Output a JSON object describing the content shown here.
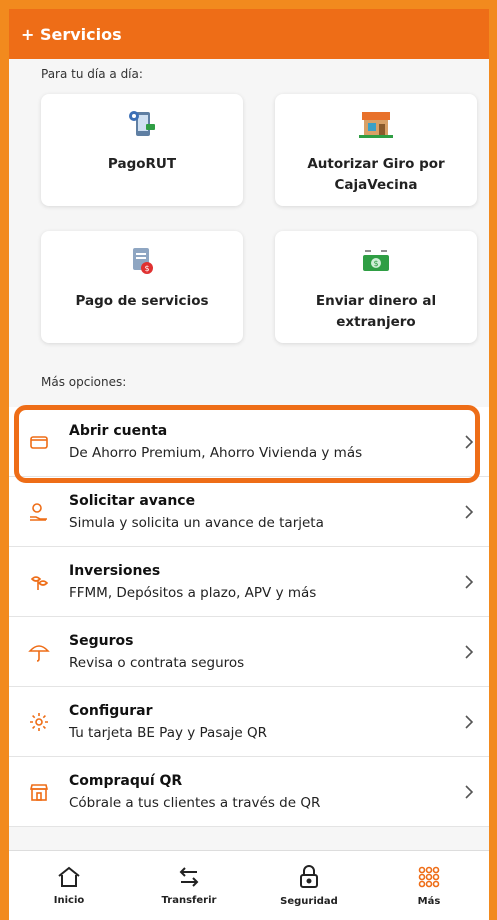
{
  "header": {
    "title": "+ Servicios"
  },
  "sections": {
    "daily_label": "Para tu día a día:",
    "more_label": "Más opciones:"
  },
  "cards": [
    {
      "label": "PagoRUT",
      "icon": "phone-payment-icon"
    },
    {
      "label": "Autorizar Giro por CajaVecina",
      "icon": "storefront-icon"
    },
    {
      "label": "Pago de servicios",
      "icon": "bill-icon"
    },
    {
      "label": "Enviar dinero al extranjero",
      "icon": "money-transfer-icon"
    }
  ],
  "options": [
    {
      "title": "Abrir cuenta",
      "subtitle": "De Ahorro Premium, Ahorro Vivienda y más",
      "icon": "wallet-icon"
    },
    {
      "title": "Solicitar avance",
      "subtitle": "Simula y solicita un avance de tarjeta",
      "icon": "hand-money-icon"
    },
    {
      "title": "Inversiones",
      "subtitle": "FFMM, Depósitos a plazo, APV y más",
      "icon": "plant-icon"
    },
    {
      "title": "Seguros",
      "subtitle": "Revisa o contrata seguros",
      "icon": "umbrella-icon"
    },
    {
      "title": "Configurar",
      "subtitle": "Tu tarjeta BE Pay y Pasaje QR",
      "icon": "gear-icon"
    },
    {
      "title": "Compraquí QR",
      "subtitle": "Cóbrale a tus clientes a través de QR",
      "icon": "shop-icon"
    }
  ],
  "tabs": [
    {
      "label": "Inicio",
      "icon": "home-icon"
    },
    {
      "label": "Transferir",
      "icon": "transfer-arrows-icon"
    },
    {
      "label": "Seguridad",
      "icon": "lock-icon"
    },
    {
      "label": "Más",
      "icon": "grid-dots-icon"
    }
  ],
  "colors": {
    "brand_orange": "#ee6d17",
    "accent_green": "#2f9e44",
    "accent_red": "#e03131"
  }
}
